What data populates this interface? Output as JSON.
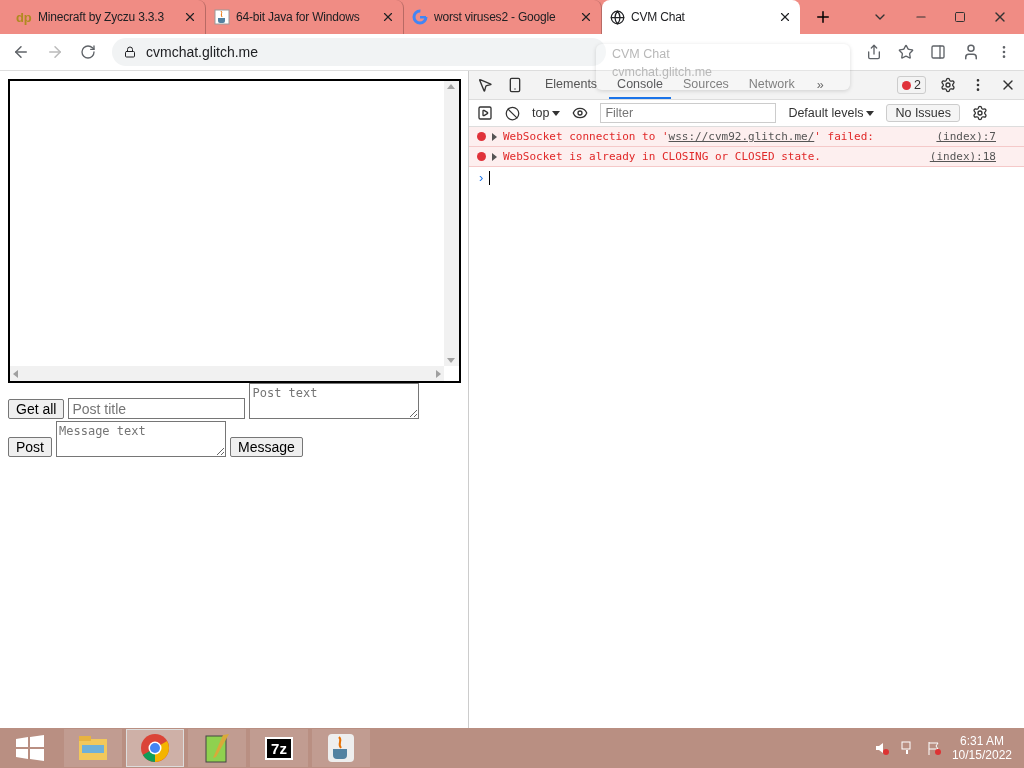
{
  "tabs": [
    {
      "favicon": "dp",
      "kind": "text",
      "title": "Minecraft by Zyczu 3.3.3",
      "selected": false
    },
    {
      "kind": "java",
      "title": "64-bit Java for Windows",
      "selected": false
    },
    {
      "kind": "google",
      "title": "worst viruses2 - Google",
      "selected": false
    },
    {
      "kind": "globe",
      "title": "CVM Chat",
      "selected": true
    }
  ],
  "address": {
    "url": "cvmchat.glitch.me"
  },
  "hover_card": {
    "title": "CVM Chat",
    "url": "cvmchat.glitch.me"
  },
  "page": {
    "buttons": [
      "Get all",
      "Post",
      "Message"
    ],
    "post_title": {
      "placeholder": "Post title"
    },
    "post_text": {
      "placeholder": "Post text"
    },
    "message_text": {
      "placeholder": "Message text"
    }
  },
  "devtools": {
    "tabs": [
      {
        "label": "Elements",
        "selected": false
      },
      {
        "label": "Console",
        "selected": true
      },
      {
        "label": "Sources",
        "selected": false
      },
      {
        "label": "Network",
        "selected": false
      }
    ],
    "more": "»",
    "error_count": "2",
    "context": "top",
    "filter": {
      "placeholder": "Filter"
    },
    "levels": "Default levels",
    "issues": "No Issues",
    "messages": [
      {
        "before": "WebSocket connection to '",
        "link": "wss://cvm92.glitch.me/",
        "after": "' failed:",
        "source": "(index):7"
      },
      {
        "before": "WebSocket is already in CLOSING or CLOSED state.",
        "source": "(index):18"
      }
    ],
    "prompt": "›"
  },
  "taskbar": {
    "apps": [
      {
        "kind": "explorer",
        "active": false
      },
      {
        "kind": "chrome",
        "active": true
      },
      {
        "kind": "notepad",
        "active": false
      },
      {
        "kind": "text",
        "label": "7z",
        "active": false
      },
      {
        "kind": "java",
        "active": false
      }
    ],
    "time": "6:31 AM",
    "date": "10/15/2022"
  }
}
